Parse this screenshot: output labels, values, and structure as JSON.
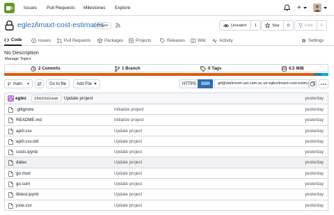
{
  "nav": {
    "items": [
      "Issues",
      "Pull Requests",
      "Milestones",
      "Explore"
    ],
    "plus_label": "+"
  },
  "repo": {
    "owner": "eglez",
    "separator": "/",
    "name": "imaxt-cost-estimates",
    "visibility": "Private",
    "unwatch_label": "Unwatch",
    "unwatch_count": "1",
    "star_label": "Star",
    "star_count": "0",
    "fork_label": "Fork",
    "fork_count": "0"
  },
  "tabs": [
    "Code",
    "Issues",
    "Pull Requests",
    "Packages",
    "Projects",
    "Releases",
    "Wiki",
    "Activity"
  ],
  "settings_label": "Settings",
  "description": "No Description",
  "manage_topics": "Manage Topics",
  "stats": {
    "commits": "2 Commits",
    "branches": "1 Branch",
    "tags": "0 Tags",
    "size": "6.5 MiB"
  },
  "language_colors": [
    "#DA5B0B",
    "#3572A5",
    "#00ADD8"
  ],
  "language_shares": [
    0.956,
    0.022,
    0.022
  ],
  "branch": {
    "current": "main",
    "go_to_file": "Go to file",
    "add_file": "Add File",
    "https": "HTTPS",
    "ssh": "SSH",
    "clone_url": "git@darkroom.ast.cam.ac.uk:eglez/imaxt-cost-estimates.git"
  },
  "latest_commit": {
    "author": "eglez",
    "sha": "2b035d2aab",
    "message": "Update project",
    "time": "yesterday"
  },
  "files": [
    {
      "name": ".gitignore",
      "message": "Initialize project",
      "time": "yesterday"
    },
    {
      "name": "README.md",
      "message": "Initialize project",
      "time": "yesterday"
    },
    {
      "name": "april.csv",
      "message": "Update project",
      "time": "yesterday"
    },
    {
      "name": "april.csv.old",
      "message": "Update project",
      "time": "yesterday"
    },
    {
      "name": "costs.ipynb",
      "message": "Update project",
      "time": "yesterday"
    },
    {
      "name": "dates",
      "message": "Update project",
      "time": "yesterday"
    },
    {
      "name": "go.mod",
      "message": "Update project",
      "time": "yesterday"
    },
    {
      "name": "go.sum",
      "message": "Update project",
      "time": "yesterday"
    },
    {
      "name": "itktest.ipynb",
      "message": "Update project",
      "time": "yesterday"
    },
    {
      "name": "june.csv",
      "message": "Update project",
      "time": "yesterday"
    }
  ],
  "colors": {
    "accent": "#609926",
    "link": "#2e6eb5",
    "ssh_active": "#2e6eb5"
  }
}
